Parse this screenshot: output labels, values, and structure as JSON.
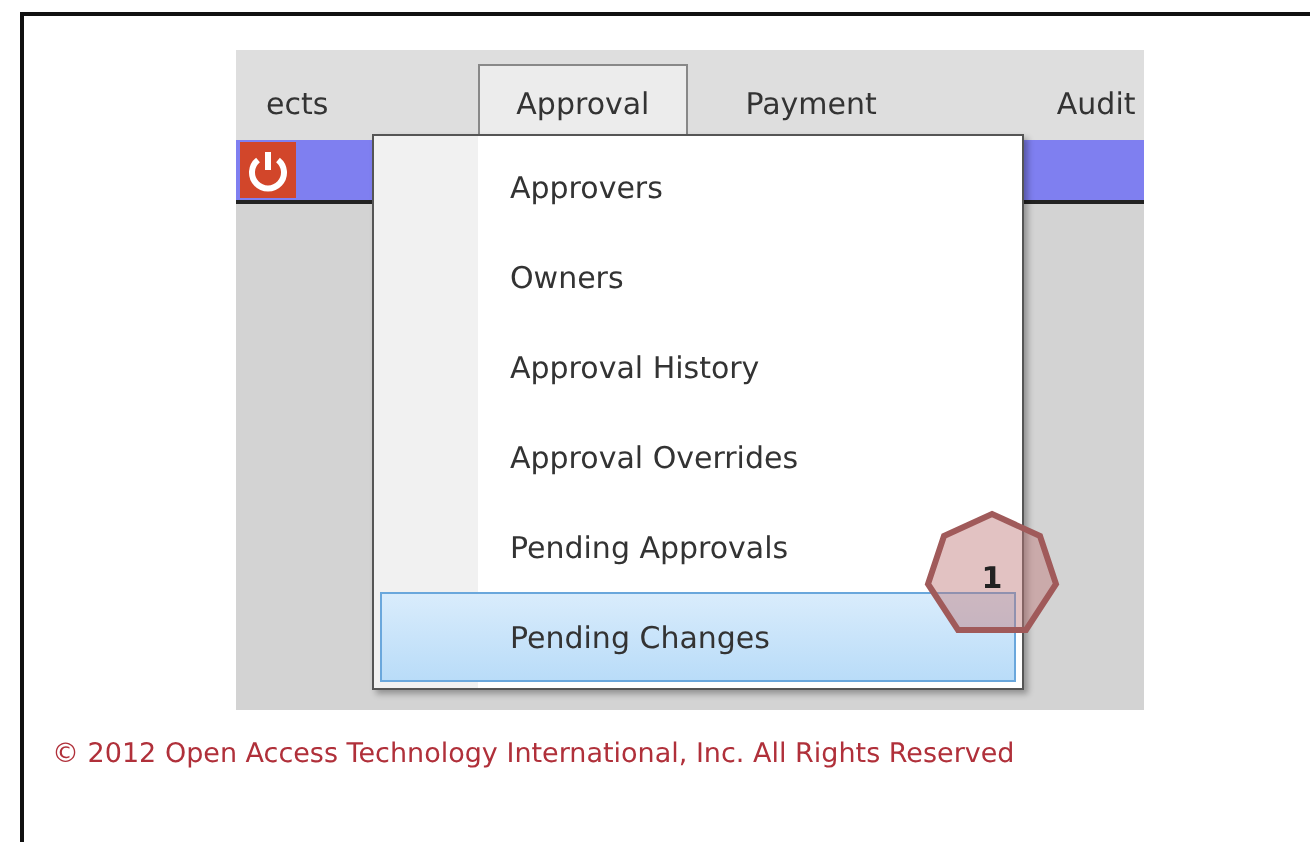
{
  "menu_bar": [
    {
      "label": "ects",
      "selected": false
    },
    {
      "label": "Approval",
      "selected": true
    },
    {
      "label": "Payment",
      "selected": false
    },
    {
      "label": "Audit",
      "selected": false
    }
  ],
  "dropdown": [
    {
      "label": "Approvers",
      "selected": false
    },
    {
      "label": "Owners",
      "selected": false
    },
    {
      "label": "Approval History",
      "selected": false
    },
    {
      "label": "Approval Overrides",
      "selected": false
    },
    {
      "label": "Pending Approvals",
      "selected": false
    },
    {
      "label": "Pending Changes",
      "selected": true
    }
  ],
  "callout": {
    "label": "1"
  },
  "footer": "© 2012 Open Access Technology International, Inc. All Rights Reserved"
}
